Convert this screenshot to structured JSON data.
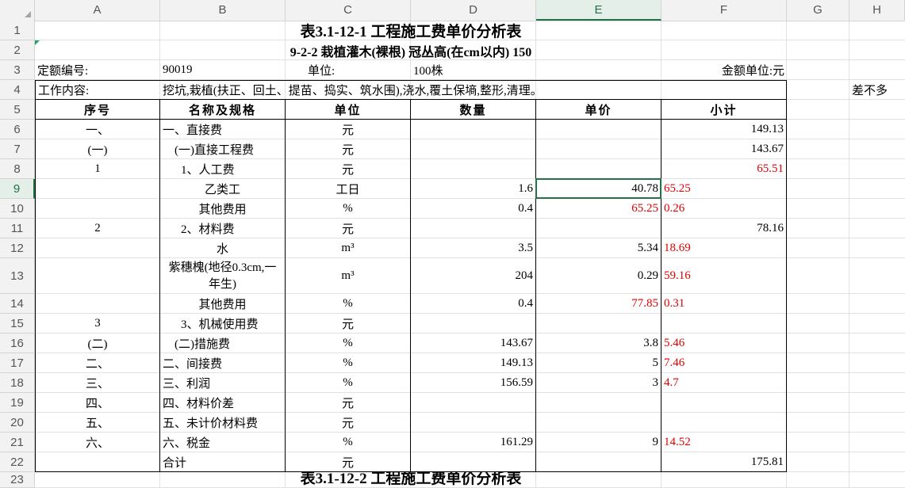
{
  "columns": [
    "A",
    "B",
    "C",
    "D",
    "E",
    "F",
    "G",
    "H"
  ],
  "selected_column": "E",
  "selected_row": "9",
  "rows": [
    "1",
    "2",
    "3",
    "4",
    "5",
    "6",
    "7",
    "8",
    "9",
    "10",
    "11",
    "12",
    "13",
    "14",
    "15",
    "16",
    "17",
    "18",
    "19",
    "20",
    "21",
    "22",
    "23"
  ],
  "title": "表3.1-12-1  工程施工费单价分析表",
  "subtitle": "9-2-2 栽植灌木(裸根) 冠丛高(在cm以内)  150",
  "quota_label": "定额编号:",
  "quota_no": "90019",
  "unit_label": "单位:",
  "unit_value": "100株",
  "amount_unit": "金额单位:元",
  "work_label": "工作内容:",
  "work_content": "挖坑,栽植(扶正、回土、提苗、捣实、筑水围),浇水,覆土保墒,整形,清理。",
  "note_h4": "差不多",
  "headers": {
    "no": "序号",
    "name": "名称及规格",
    "unit": "单位",
    "qty": "数量",
    "price": "单价",
    "subtotal": "小计"
  },
  "table": [
    {
      "no": "一、",
      "name": "一、直接费",
      "unit": "元",
      "qty": "",
      "price": "",
      "subtotal": "149.13"
    },
    {
      "no": "(一)",
      "name": "(一)直接工程费",
      "unit": "元",
      "qty": "",
      "price": "",
      "subtotal": "143.67"
    },
    {
      "no": "1",
      "name": "1、人工费",
      "unit": "元",
      "qty": "",
      "price": "",
      "subtotal": "65.51"
    },
    {
      "no": "",
      "name": "乙类工",
      "unit": "工日",
      "qty": "1.6",
      "price": "40.78",
      "subtotal": "65.25"
    },
    {
      "no": "",
      "name": "其他费用",
      "unit": "%",
      "qty": "0.4",
      "price": "65.25",
      "subtotal": "0.26"
    },
    {
      "no": "2",
      "name": "2、材料费",
      "unit": "元",
      "qty": "",
      "price": "",
      "subtotal": "78.16"
    },
    {
      "no": "",
      "name": "水",
      "unit": "m³",
      "qty": "3.5",
      "price": "5.34",
      "subtotal": "18.69"
    },
    {
      "no": "",
      "name": "紫穗槐(地径0.3cm,一年生)",
      "unit": "m³",
      "qty": "204",
      "price": "0.29",
      "subtotal": "59.16"
    },
    {
      "no": "",
      "name": "其他费用",
      "unit": "%",
      "qty": "0.4",
      "price": "77.85",
      "subtotal": "0.31"
    },
    {
      "no": "3",
      "name": "3、机械使用费",
      "unit": "元",
      "qty": "",
      "price": "",
      "subtotal": ""
    },
    {
      "no": "(二)",
      "name": "(二)措施费",
      "unit": "%",
      "qty": "143.67",
      "price": "3.8",
      "subtotal": "5.46"
    },
    {
      "no": "二、",
      "name": "二、间接费",
      "unit": "%",
      "qty": "149.13",
      "price": "5",
      "subtotal": "7.46"
    },
    {
      "no": "三、",
      "name": "三、利润",
      "unit": "%",
      "qty": "156.59",
      "price": "3",
      "subtotal": "4.7"
    },
    {
      "no": "四、",
      "name": "四、材料价差",
      "unit": "元",
      "qty": "",
      "price": "",
      "subtotal": ""
    },
    {
      "no": "五、",
      "name": "五、未计价材料费",
      "unit": "元",
      "qty": "",
      "price": "",
      "subtotal": ""
    },
    {
      "no": "六、",
      "name": "六、税金",
      "unit": "%",
      "qty": "161.29",
      "price": "9",
      "subtotal": "14.52"
    },
    {
      "no": "",
      "name": "合计",
      "unit": "元",
      "qty": "",
      "price": "",
      "subtotal": "175.81"
    }
  ],
  "next_title": "表3.1-12-2  工程施工费单价分析表",
  "colors": {
    "accent": "#217346",
    "red_text": "#e00000",
    "header_bg": "#f2f2f2"
  }
}
